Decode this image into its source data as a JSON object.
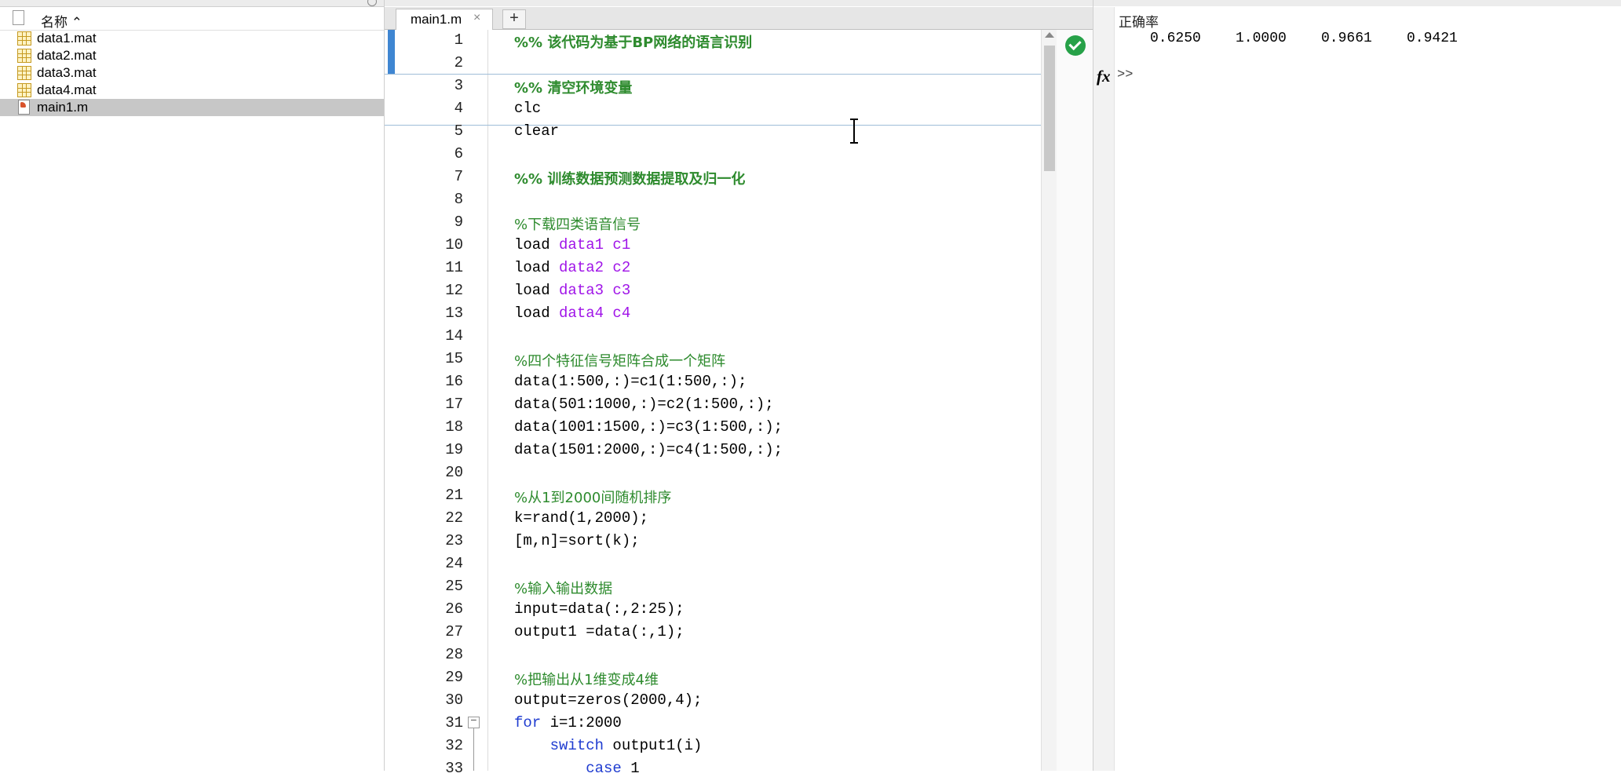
{
  "file_browser": {
    "column_header": "名称 ⌃",
    "files": [
      {
        "name": "data1.mat",
        "type": "mat"
      },
      {
        "name": "data2.mat",
        "type": "mat"
      },
      {
        "name": "data3.mat",
        "type": "mat"
      },
      {
        "name": "data4.mat",
        "type": "mat"
      },
      {
        "name": "main1.m",
        "type": "m"
      }
    ]
  },
  "editor": {
    "tab_label": "main1.m",
    "tab_close": "×",
    "tab_add": "+",
    "code_analyzer_status": "ok-icon",
    "lines": [
      {
        "n": "1",
        "segs": [
          {
            "t": "%% 该代码为基于BP网络的语言识别",
            "c": "cm b"
          }
        ]
      },
      {
        "n": "2",
        "segs": []
      },
      {
        "n": "3",
        "segs": [
          {
            "t": "%% 清空环境变量",
            "c": "cm b"
          }
        ]
      },
      {
        "n": "4",
        "segs": [
          {
            "t": "clc",
            "c": ""
          }
        ]
      },
      {
        "n": "5",
        "segs": [
          {
            "t": "clear",
            "c": ""
          }
        ]
      },
      {
        "n": "6",
        "segs": []
      },
      {
        "n": "7",
        "segs": [
          {
            "t": "%% 训练数据预测数据提取及归一化",
            "c": "cm b"
          }
        ]
      },
      {
        "n": "8",
        "segs": []
      },
      {
        "n": "9",
        "segs": [
          {
            "t": "%下载四类语音信号",
            "c": "cm"
          }
        ]
      },
      {
        "n": "10",
        "segs": [
          {
            "t": "load ",
            "c": ""
          },
          {
            "t": "data1 c1",
            "c": "str"
          }
        ]
      },
      {
        "n": "11",
        "segs": [
          {
            "t": "load ",
            "c": ""
          },
          {
            "t": "data2 c2",
            "c": "str"
          }
        ]
      },
      {
        "n": "12",
        "segs": [
          {
            "t": "load ",
            "c": ""
          },
          {
            "t": "data3 c3",
            "c": "str"
          }
        ]
      },
      {
        "n": "13",
        "segs": [
          {
            "t": "load ",
            "c": ""
          },
          {
            "t": "data4 c4",
            "c": "str"
          }
        ]
      },
      {
        "n": "14",
        "segs": []
      },
      {
        "n": "15",
        "segs": [
          {
            "t": "%四个特征信号矩阵合成一个矩阵",
            "c": "cm"
          }
        ]
      },
      {
        "n": "16",
        "segs": [
          {
            "t": "data(1:500,:)=c1(1:500,:);",
            "c": ""
          }
        ]
      },
      {
        "n": "17",
        "segs": [
          {
            "t": "data(501:1000,:)=c2(1:500,:);",
            "c": ""
          }
        ]
      },
      {
        "n": "18",
        "segs": [
          {
            "t": "data(1001:1500,:)=c3(1:500,:);",
            "c": ""
          }
        ]
      },
      {
        "n": "19",
        "segs": [
          {
            "t": "data(1501:2000,:)=c4(1:500,:);",
            "c": ""
          }
        ]
      },
      {
        "n": "20",
        "segs": []
      },
      {
        "n": "21",
        "segs": [
          {
            "t": "%从1到2000间随机排序",
            "c": "cm"
          }
        ]
      },
      {
        "n": "22",
        "segs": [
          {
            "t": "k=rand(1,2000);",
            "c": ""
          }
        ]
      },
      {
        "n": "23",
        "segs": [
          {
            "t": "[m,n]=sort(k);",
            "c": ""
          }
        ]
      },
      {
        "n": "24",
        "segs": []
      },
      {
        "n": "25",
        "segs": [
          {
            "t": "%输入输出数据",
            "c": "cm"
          }
        ]
      },
      {
        "n": "26",
        "segs": [
          {
            "t": "input=data(:,2:25);",
            "c": ""
          }
        ]
      },
      {
        "n": "27",
        "segs": [
          {
            "t": "output1 =data(:,1);",
            "c": ""
          }
        ]
      },
      {
        "n": "28",
        "segs": []
      },
      {
        "n": "29",
        "segs": [
          {
            "t": "%把输出从1维变成4维",
            "c": "cm"
          }
        ]
      },
      {
        "n": "30",
        "segs": [
          {
            "t": "output=zeros(2000,4);",
            "c": ""
          }
        ]
      },
      {
        "n": "31",
        "segs": [
          {
            "t": "for",
            "c": "kw"
          },
          {
            "t": " i=1:2000",
            "c": ""
          }
        ]
      },
      {
        "n": "32",
        "segs": [
          {
            "t": "    ",
            "c": ""
          },
          {
            "t": "switch",
            "c": "kw"
          },
          {
            "t": " output1(i)",
            "c": ""
          }
        ]
      },
      {
        "n": "33",
        "segs": [
          {
            "t": "        ",
            "c": ""
          },
          {
            "t": "case",
            "c": "kw"
          },
          {
            "t": " 1",
            "c": ""
          }
        ]
      }
    ],
    "fold_marker": "−"
  },
  "command_window": {
    "label": "正确率",
    "values": [
      "0.6250",
      "1.0000",
      "0.9661",
      "0.9421"
    ],
    "fx": "fx",
    "prompt": ">>"
  },
  "colors": {
    "comment": "#2e8b2e",
    "string": "#a014e8",
    "keyword": "#1f3cd0",
    "selection": "#c7c7c7",
    "ok": "#26a148"
  }
}
